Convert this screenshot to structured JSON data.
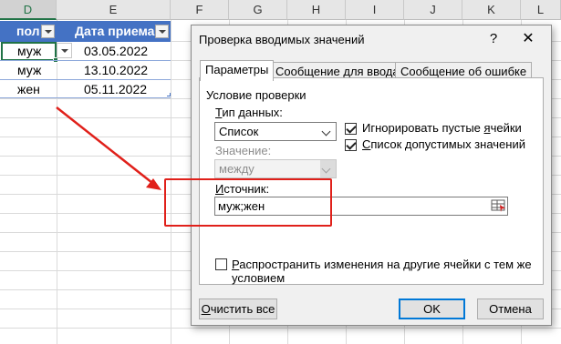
{
  "sheet": {
    "columns": [
      "D",
      "E",
      "F",
      "G",
      "H",
      "I",
      "J",
      "K",
      "L"
    ],
    "table_headers": [
      "пол",
      "Дата приема"
    ],
    "rows": [
      {
        "gender": "муж",
        "date": "03.05.2022"
      },
      {
        "gender": "муж",
        "date": "13.10.2022"
      },
      {
        "gender": "жен",
        "date": "05.11.2022"
      }
    ],
    "header_color": "#4472c4",
    "selection_color": "#217346"
  },
  "dialog": {
    "title": "Проверка вводимых значений",
    "help": "?",
    "close": "✕",
    "tabs": [
      "Параметры",
      "Сообщение для ввода",
      "Сообщение об ошибке"
    ],
    "group_label": "Условие проверки",
    "data_type_label_u": "Т",
    "data_type_label_rest": "ип данных:",
    "data_type_value": "Список",
    "ignore_blank_label_pre": "Игнорировать пустые ",
    "ignore_blank_label_u": "я",
    "ignore_blank_label_post": "чейки",
    "ignore_blank_checked": true,
    "in_cell_dropdown_label_u": "С",
    "in_cell_dropdown_label_rest": "писок допустимых значений",
    "in_cell_dropdown_checked": true,
    "value_label": "Значение:",
    "value_value": "между",
    "source_label_u": "И",
    "source_label_rest": "сточник:",
    "source_value": "муж;жен",
    "apply_all_label_u": "Р",
    "apply_all_label_rest_line1": "аспространить изменения на другие ячейки с тем же",
    "apply_all_label_line2": "условием",
    "apply_all_checked": false,
    "clear_all_u": "О",
    "clear_all_rest": "чистить все",
    "ok_label": "OK",
    "cancel_label": "Отмена",
    "accent_color": "#0078d7"
  },
  "annotation": {
    "color": "#e0201a"
  }
}
